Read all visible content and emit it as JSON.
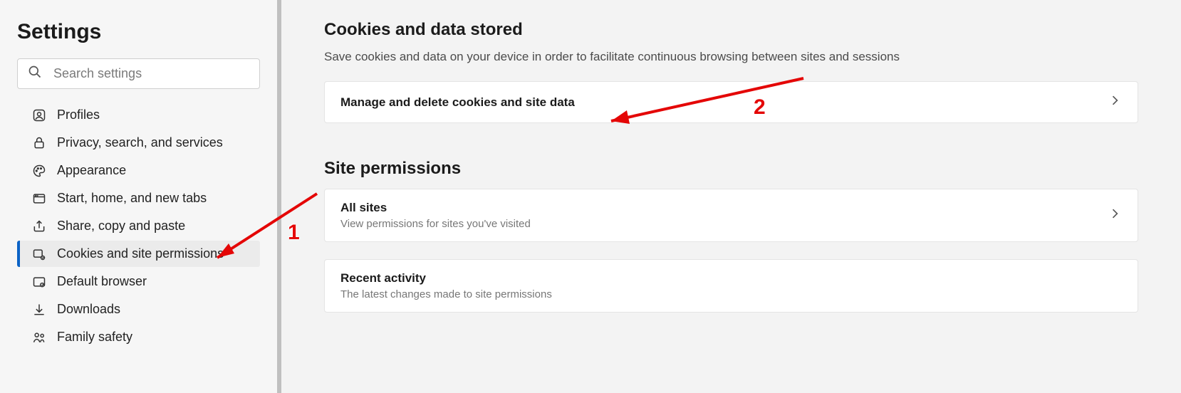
{
  "sidebar": {
    "title": "Settings",
    "search_placeholder": "Search settings",
    "items": [
      {
        "label": "Profiles"
      },
      {
        "label": "Privacy, search, and services"
      },
      {
        "label": "Appearance"
      },
      {
        "label": "Start, home, and new tabs"
      },
      {
        "label": "Share, copy and paste"
      },
      {
        "label": "Cookies and site permissions"
      },
      {
        "label": "Default browser"
      },
      {
        "label": "Downloads"
      },
      {
        "label": "Family safety"
      }
    ]
  },
  "cookies_section": {
    "title": "Cookies and data stored",
    "desc": "Save cookies and data on your device in order to facilitate continuous browsing between sites and sessions",
    "manage_label": "Manage and delete cookies and site data"
  },
  "permissions_section": {
    "title": "Site permissions",
    "all_sites_title": "All sites",
    "all_sites_sub": "View permissions for sites you've visited",
    "recent_title": "Recent activity",
    "recent_sub": "The latest changes made to site permissions"
  },
  "annotations": {
    "one": "1",
    "two": "2"
  }
}
